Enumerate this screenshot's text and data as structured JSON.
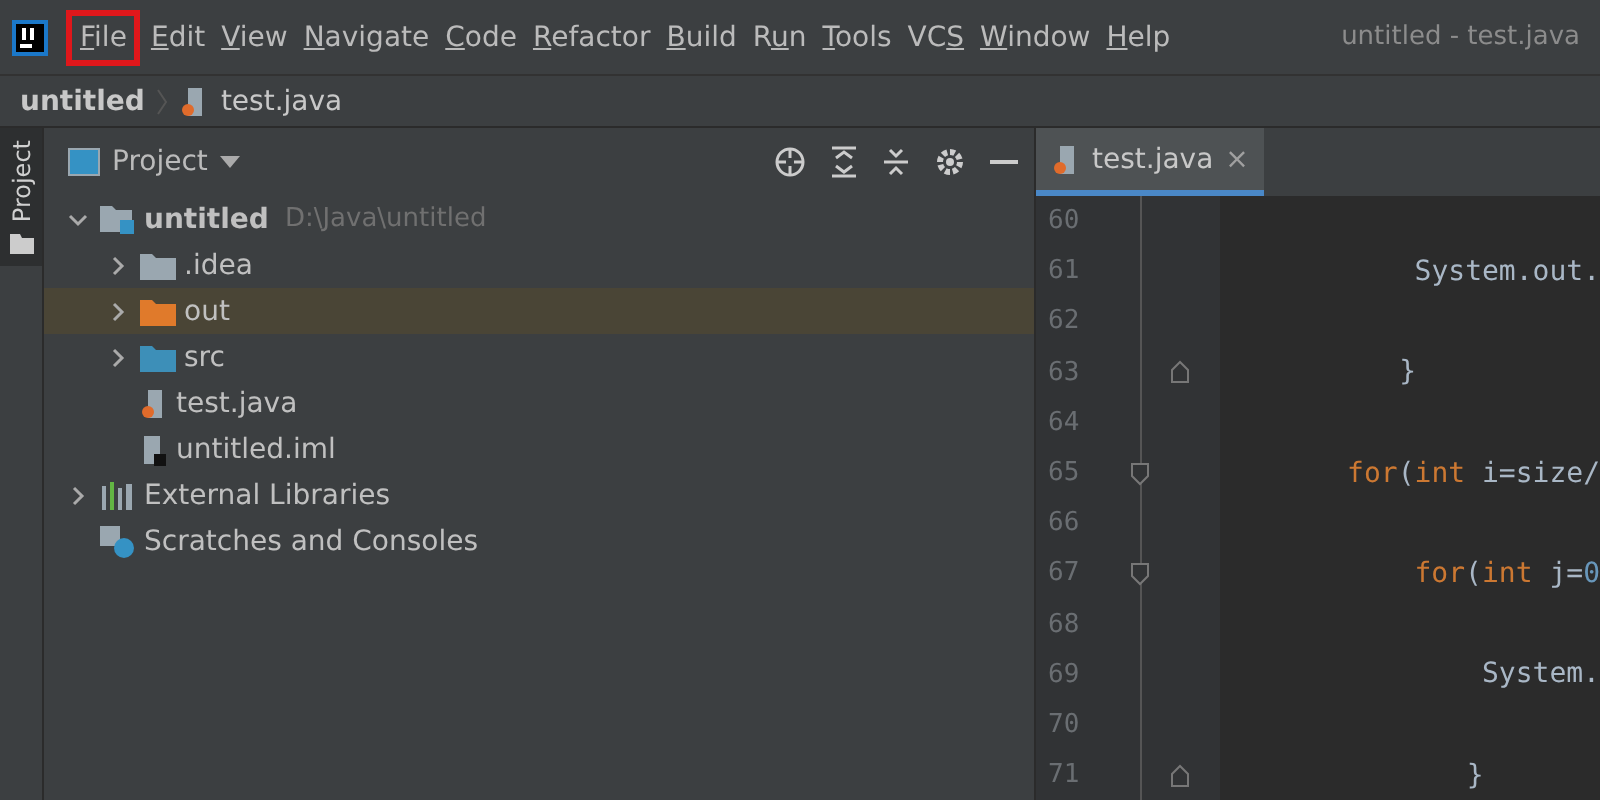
{
  "menu_bar": {
    "items": [
      {
        "key": "F",
        "post": "ile",
        "highlighted": true
      },
      {
        "key": "E",
        "post": "dit",
        "highlighted": false
      },
      {
        "key": "V",
        "post": "iew",
        "highlighted": false
      },
      {
        "key": "N",
        "post": "avigate",
        "highlighted": false
      },
      {
        "key": "C",
        "post": "ode",
        "highlighted": false
      },
      {
        "key": "R",
        "post": "efactor",
        "highlighted": false
      },
      {
        "key": "B",
        "post": "uild",
        "highlighted": false
      },
      {
        "pre": "R",
        "key": "u",
        "post": "n",
        "highlighted": false
      },
      {
        "key": "T",
        "post": "ools",
        "highlighted": false
      },
      {
        "pre": "VC",
        "key": "S",
        "highlighted": false
      },
      {
        "key": "W",
        "post": "indow",
        "highlighted": false
      },
      {
        "key": "H",
        "post": "elp",
        "highlighted": false
      }
    ],
    "title": "untitled - test.java"
  },
  "breadcrumb": [
    {
      "label": "untitled"
    },
    {
      "label": "test.java",
      "kind": "java"
    }
  ],
  "tool_stripe": {
    "label": "Project"
  },
  "project_panel": {
    "title": "Project",
    "tree": [
      {
        "label": "untitled",
        "path": "D:\\Java\\untitled",
        "kind": "module",
        "expanded": true,
        "selected": false,
        "children": [
          {
            "label": ".idea",
            "kind": "folder",
            "expanded": false,
            "selected": false
          },
          {
            "label": "out",
            "kind": "excluded",
            "expanded": false,
            "selected": true
          },
          {
            "label": "src",
            "kind": "source",
            "expanded": false,
            "selected": false
          },
          {
            "label": "test.java",
            "kind": "java",
            "selected": false
          },
          {
            "label": "untitled.iml",
            "kind": "iml",
            "selected": false
          }
        ]
      },
      {
        "label": "External Libraries",
        "kind": "libraries",
        "expanded": false,
        "selected": false
      },
      {
        "label": "Scratches and Consoles",
        "kind": "scratches",
        "selected": false
      }
    ]
  },
  "editor": {
    "tabs": [
      {
        "label": "test.java",
        "close": "×",
        "selected": true
      }
    ],
    "lines": [
      {
        "number": "60",
        "kind": "plain"
      },
      {
        "number": "61",
        "kind": "plain",
        "tokens": [
          {
            "text": "System.out.",
            "kind": "plain"
          }
        ]
      },
      {
        "number": "62",
        "kind": "plain"
      },
      {
        "number": "63",
        "kind": "foldend",
        "tokens": [
          {
            "text": "}",
            "kind": "plain"
          }
        ]
      },
      {
        "number": "64",
        "kind": "plain"
      },
      {
        "number": "65",
        "kind": "foldstart",
        "tokens": [
          {
            "text": "for",
            "kind": "keyword"
          },
          {
            "text": "(",
            "kind": "plain"
          },
          {
            "text": "int",
            "kind": "keyword"
          },
          {
            "text": " i=size/",
            "kind": "plain"
          }
        ]
      },
      {
        "number": "66",
        "kind": "plain"
      },
      {
        "number": "67",
        "kind": "foldstart",
        "tokens": [
          {
            "text": "for",
            "kind": "keyword"
          },
          {
            "text": "(",
            "kind": "plain"
          },
          {
            "text": "int",
            "kind": "keyword"
          },
          {
            "text": " j=",
            "kind": "plain"
          },
          {
            "text": "0",
            "kind": "number"
          }
        ]
      },
      {
        "number": "68",
        "kind": "plain"
      },
      {
        "number": "69",
        "kind": "plain",
        "tokens": [
          {
            "text": "System.",
            "kind": "plain"
          }
        ]
      },
      {
        "number": "70",
        "kind": "plain"
      },
      {
        "number": "71",
        "kind": "foldend",
        "tokens": [
          {
            "text": "}",
            "kind": "plain"
          }
        ]
      }
    ]
  }
}
